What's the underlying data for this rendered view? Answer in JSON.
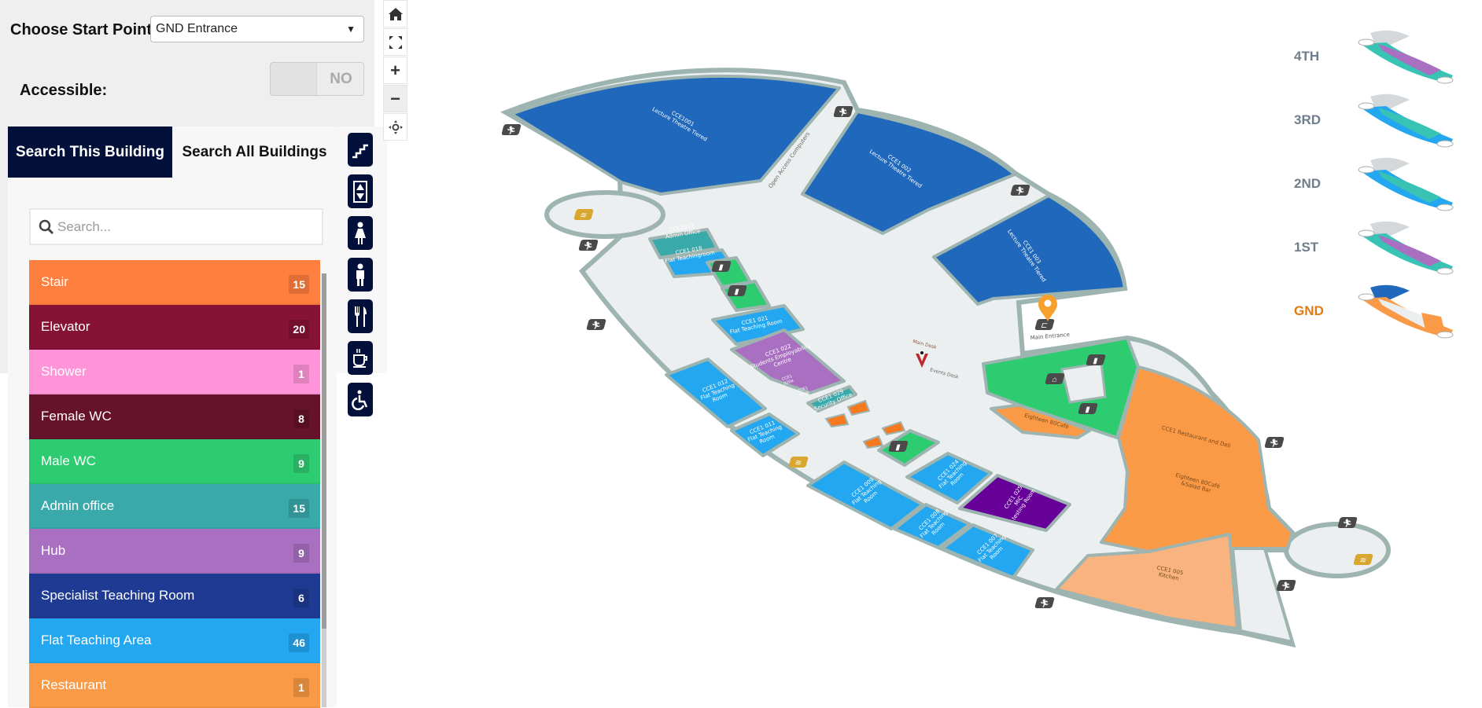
{
  "controls": {
    "start_label": "Choose Start Point:",
    "start_value": "GND Entrance",
    "accessible_label": "Accessible:",
    "accessible_value": "NO"
  },
  "tabs": [
    {
      "label": "Search This Building",
      "active": true
    },
    {
      "label": "Search All Buildings",
      "active": false
    }
  ],
  "search": {
    "placeholder": "Search..."
  },
  "categories": [
    {
      "label": "Stair",
      "count": "15",
      "color": "#ff7f3f"
    },
    {
      "label": "Elevator",
      "count": "20",
      "color": "#861236"
    },
    {
      "label": "Shower",
      "count": "1",
      "color": "#ff95d8"
    },
    {
      "label": "Female WC",
      "count": "8",
      "color": "#65122a"
    },
    {
      "label": "Male WC",
      "count": "9",
      "color": "#2ecc71"
    },
    {
      "label": "Admin office",
      "count": "15",
      "color": "#39a9a9"
    },
    {
      "label": "Hub",
      "count": "9",
      "color": "#a970c1"
    },
    {
      "label": "Specialist Teaching Room",
      "count": "6",
      "color": "#1f3a93"
    },
    {
      "label": "Flat Teaching Area",
      "count": "46",
      "color": "#22a7f0"
    },
    {
      "label": "Restaurant",
      "count": "1",
      "color": "#fa9a47"
    }
  ],
  "filter_icons": [
    "stairs-icon",
    "elevator-icon",
    "female-wc-icon",
    "male-wc-icon",
    "restaurant-icon",
    "cafe-icon",
    "accessible-icon"
  ],
  "map_controls": [
    "home-icon",
    "fullscreen-icon",
    "zoom-in-icon",
    "zoom-out-icon",
    "locate-icon"
  ],
  "floors": [
    {
      "label": "4TH",
      "active": false
    },
    {
      "label": "3RD",
      "active": false
    },
    {
      "label": "2ND",
      "active": false
    },
    {
      "label": "1ST",
      "active": false
    },
    {
      "label": "GND",
      "active": true
    }
  ],
  "map": {
    "rooms": [
      {
        "lines": [
          "CCE1001",
          "Lecture Theatre Tiered"
        ],
        "color": "#1f68bb"
      },
      {
        "lines": [
          "CCE1 002",
          "Lecture Theatre Tiered"
        ],
        "color": "#1f68bb"
      },
      {
        "lines": [
          "CCE1 003",
          "Lecture Theatre Tiered"
        ],
        "color": "#1f68bb"
      },
      {
        "lines": [
          "CCE1017",
          "Admin Office"
        ],
        "color": "#39a9a9"
      },
      {
        "lines": [
          "CCE1 018",
          "Flat Teachingroom"
        ],
        "color": "#22a7f0"
      },
      {
        "lines": [
          "CCE1 021",
          "Flat Teaching Room"
        ],
        "color": "#22a7f0"
      },
      {
        "lines": [
          "CCE1 022",
          "Students Employability",
          "Centre"
        ],
        "color": "#a970c1"
      },
      {
        "lines": [
          "CCE1 029",
          "Security Office"
        ],
        "color": "#39a9a9"
      },
      {
        "lines": [
          "CCE1 012",
          "Flat Teaching",
          "Room"
        ],
        "color": "#22a7f0"
      },
      {
        "lines": [
          "CCE1 011",
          "Flat Teaching",
          "Room"
        ],
        "color": "#22a7f0"
      },
      {
        "lines": [
          "CCE1 009",
          "Flat Teaching",
          "Room"
        ],
        "color": "#22a7f0"
      },
      {
        "lines": [
          "CCE1 008",
          "Flat Teaching",
          "Room"
        ],
        "color": "#22a7f0"
      },
      {
        "lines": [
          "CCE1 007",
          "Flat Teaching",
          "Room"
        ],
        "color": "#22a7f0"
      },
      {
        "lines": [
          "CCE1 024",
          "Flat Teaching",
          "Room"
        ],
        "color": "#22a7f0"
      },
      {
        "lines": [
          "CCE1 025",
          "MIC",
          "testing Room"
        ],
        "color": "#660099"
      },
      {
        "lines": [
          "CCE1 Restaurant and Deli"
        ],
        "color": "#fa9a47"
      },
      {
        "lines": [
          "CCE1 005",
          "Kitchen"
        ],
        "color": "#f8b37e"
      },
      {
        "lines": [
          "Eighteen 80Café"
        ],
        "color": "#fa9a47"
      },
      {
        "lines": [],
        "color": "#2ecc71"
      },
      {
        "lines": [],
        "color": "#2ecc71"
      },
      {
        "lines": [],
        "color": "#2ecc71"
      },
      {
        "lines": [],
        "color": "#2ecc71"
      }
    ],
    "labels": {
      "open_access": "Open Access Computers",
      "main_entrance": "Main Entrance",
      "main_desk": "Main Desk",
      "events_desk": "Events Desk",
      "cafe_bar": [
        "Eighteen 80Café",
        "&Salad Bar"
      ],
      "sub_a": [
        "CCE1",
        "020a"
      ],
      "sub_b": [
        "CCE1",
        "020b"
      ]
    },
    "pin_color": "#f7a12c"
  }
}
